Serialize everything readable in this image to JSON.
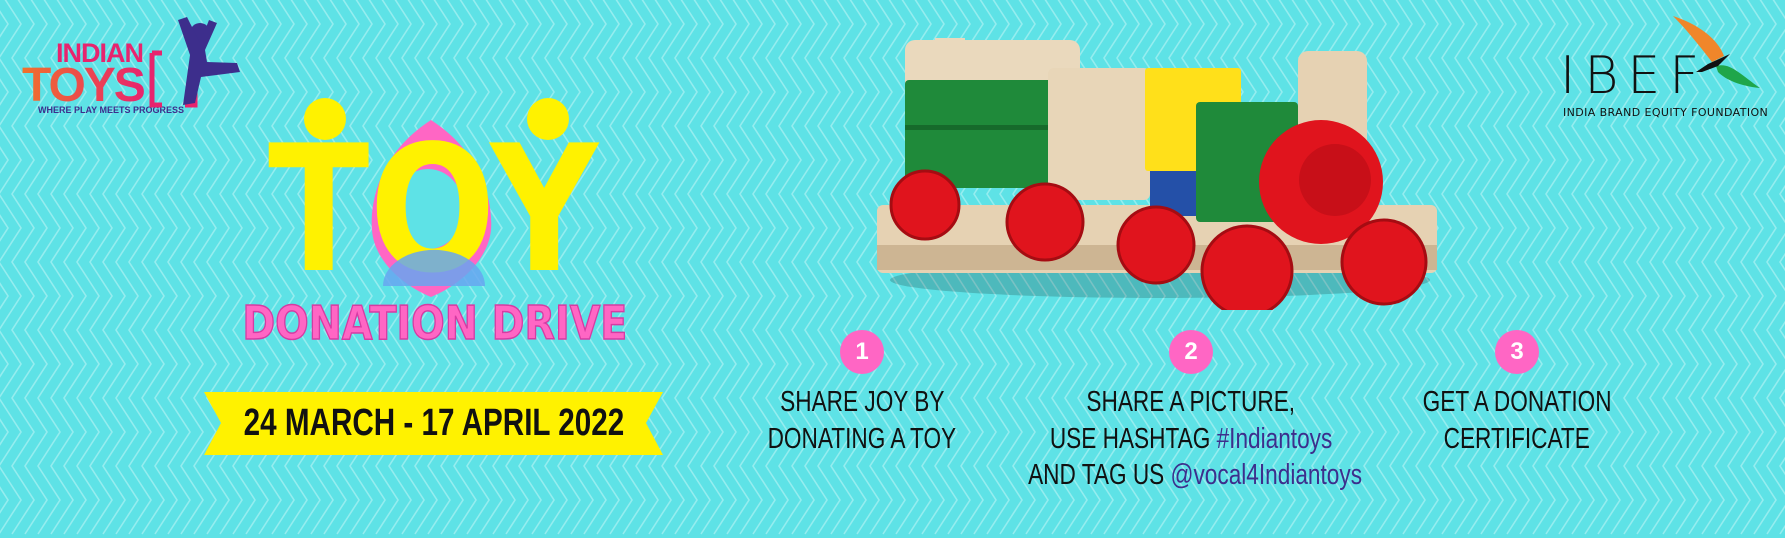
{
  "colors": {
    "background": "#5ee2e6",
    "chevron": "#a8f0f2",
    "yellow": "#fff200",
    "pink": "#ff66c4",
    "blue": "#67a6f0",
    "purple": "#3d2e8c"
  },
  "indian_toys_logo": {
    "line1": "INDIAN",
    "line2": "TOYS",
    "tagline": "WHERE PLAY MEETS PROGRESS"
  },
  "title": {
    "word": "TOY",
    "subtitle": "DONATION DRIVE"
  },
  "date_banner": "24 MARCH - 17 APRIL 2022",
  "steps": [
    {
      "number": "1",
      "lines": [
        {
          "text": "SHARE JOY BY",
          "accent": ""
        },
        {
          "text": "DONATING A TOY",
          "accent": ""
        }
      ]
    },
    {
      "number": "2",
      "lines": [
        {
          "text": "SHARE A PICTURE,",
          "accent": ""
        },
        {
          "text": "USE HASHTAG ",
          "accent": "#Indiantoys"
        },
        {
          "text": "AND TAG US ",
          "accent": "@vocal4Indiantoys"
        }
      ]
    },
    {
      "number": "3",
      "lines": [
        {
          "text": "GET A DONATION",
          "accent": ""
        },
        {
          "text": "CERTIFICATE",
          "accent": ""
        }
      ]
    }
  ],
  "ibef_logo": {
    "name": "IBEF",
    "tagline": "INDIA BRAND EQUITY FOUNDATION"
  },
  "images": {
    "hero": "wooden-toy-train"
  }
}
